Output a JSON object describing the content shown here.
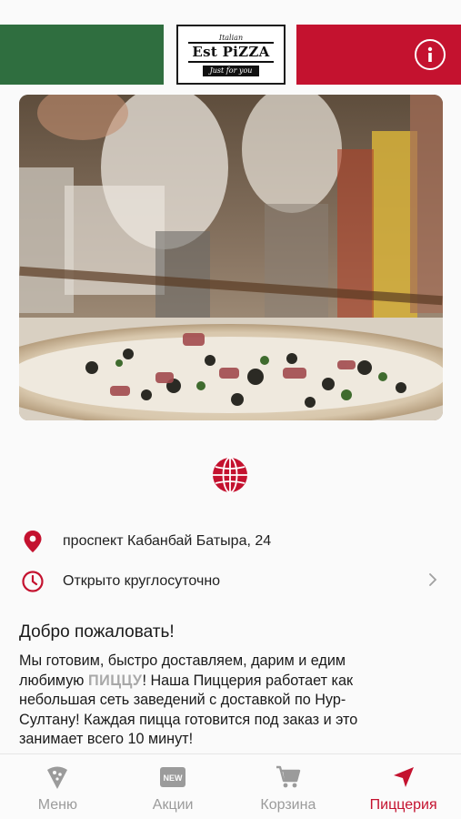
{
  "colors": {
    "brand_red": "#c4122f",
    "brand_green": "#2f6e3f",
    "inactive": "#9b9b9b"
  },
  "header": {
    "logo_top": "Italian",
    "logo_main": "Est PiZZA",
    "logo_sub": "Just for you",
    "info_icon": "info-icon"
  },
  "hero": {
    "image": "photo-pizza-with-chefs"
  },
  "website_icon": "globe-icon",
  "info": {
    "address": "проспект Кабанбай Батыра, 24",
    "hours": "Открыто круглосуточно"
  },
  "welcome": {
    "title": "Добро пожаловать!",
    "body_before": "Мы готовим, быстро доставляем, дарим и едим любимую ",
    "body_highlight": "ПИЦЦУ",
    "body_after": "! Наша Пиццерия работает как небольшая сеть заведений с доставкой по Нур-Султану! Каждая пицца готовится под заказ и это занимает всего 10 минут!"
  },
  "tabbar": {
    "tabs": [
      {
        "label": "Меню",
        "icon": "pizza-slice-icon"
      },
      {
        "label": "Акции",
        "icon": "new-badge-icon",
        "badge": "NEW"
      },
      {
        "label": "Корзина",
        "icon": "cart-icon"
      },
      {
        "label": "Пиццерия",
        "icon": "location-arrow-icon",
        "active": true
      }
    ]
  }
}
